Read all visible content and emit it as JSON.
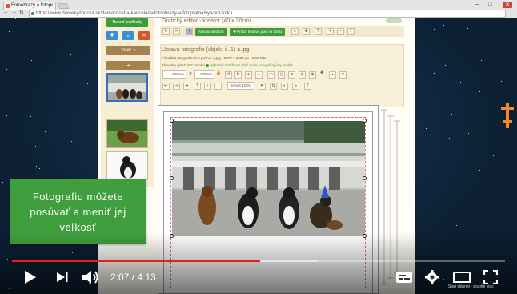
{
  "browser": {
    "tab_title": "Fotoobrazy a fotop",
    "url": "https://www.darcekydodcka.sk/domacnost-a-kancelaria/fotoobrazy-a-fotoplatna/vytvorit-fotku"
  },
  "sidebar": {
    "green_button": "Nahrať podklady",
    "button_colors": [
      "#3b8fd0",
      "#3b8fd0",
      "#d4552a"
    ],
    "brown_button_1": "Vložiť ➔",
    "brown_button_2": "➔"
  },
  "editor": {
    "title": "Grafický editor - kreátor (40 x 30cm)",
    "btn_upload": "Nahrať obrázok",
    "btn_text": "✚ Pridať textové pole na obraz",
    "panel_title": "Úprava fotografie (objekt č. 1) a.jpg",
    "source_info": "Pôvodná fotografia:  6.2 px/mm  a.jpg  |  3277 x 1969 px  |  0.92 MB",
    "current_label": "Aktuálny výrez:  6.2 px/mm",
    "current_ok": "Výborné rozlíšenie, tlač bude vo vynikajúcej kvalite",
    "width_value": "400mm",
    "height_value": "228mm",
    "opacity_label": "Sýtosť 100%"
  },
  "caption": {
    "text": "Fotografiu môžete posúvať a meniť jej veľkosť"
  },
  "player": {
    "time": "2:07 / 4:13",
    "played_fraction": 0.503,
    "loaded_fraction": 0.62,
    "watermark": "Sieň slávnej  ·  pozrite viac"
  }
}
